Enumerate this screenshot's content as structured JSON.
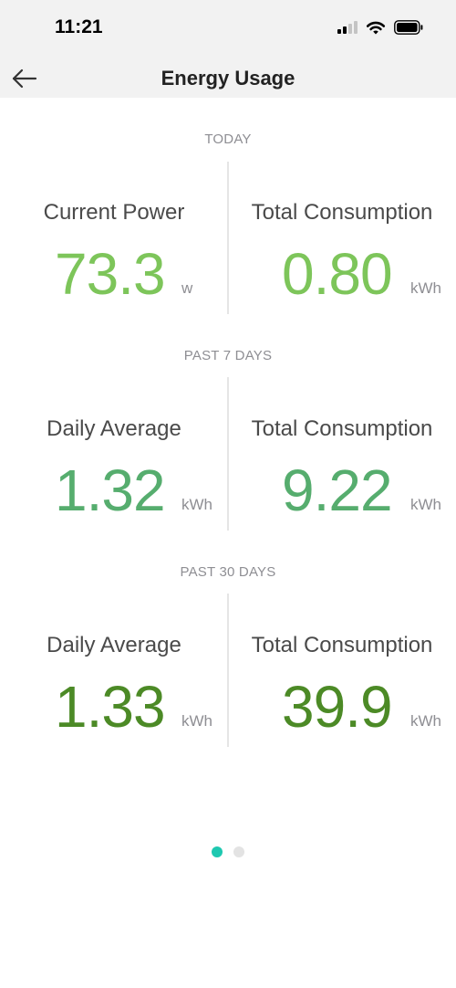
{
  "status_bar": {
    "time": "11:21"
  },
  "header": {
    "title": "Energy Usage"
  },
  "sections": {
    "today": {
      "label": "TODAY",
      "left": {
        "label": "Current Power",
        "value": "73.3",
        "unit": "w"
      },
      "right": {
        "label": "Total Consumption",
        "value": "0.80",
        "unit": "kWh"
      }
    },
    "past7": {
      "label": "PAST 7 DAYS",
      "left": {
        "label": "Daily Average",
        "value": "1.32",
        "unit": "kWh"
      },
      "right": {
        "label": "Total Consumption",
        "value": "9.22",
        "unit": "kWh"
      }
    },
    "past30": {
      "label": "PAST 30 DAYS",
      "left": {
        "label": "Daily Average",
        "value": "1.33",
        "unit": "kWh"
      },
      "right": {
        "label": "Total Consumption",
        "value": "39.9",
        "unit": "kWh"
      }
    }
  },
  "colors": {
    "today_value": "#7dc55a",
    "past7_value": "#56ad6e",
    "past30_value": "#4c8a26",
    "dot_active": "#1ec8b0",
    "dot_inactive": "#e3e3e3"
  },
  "pager": {
    "pages": 2,
    "active_index": 0
  },
  "icons": {
    "back": "arrow-left-icon",
    "signal": "cellular-signal-icon",
    "wifi": "wifi-icon",
    "battery": "battery-icon"
  }
}
